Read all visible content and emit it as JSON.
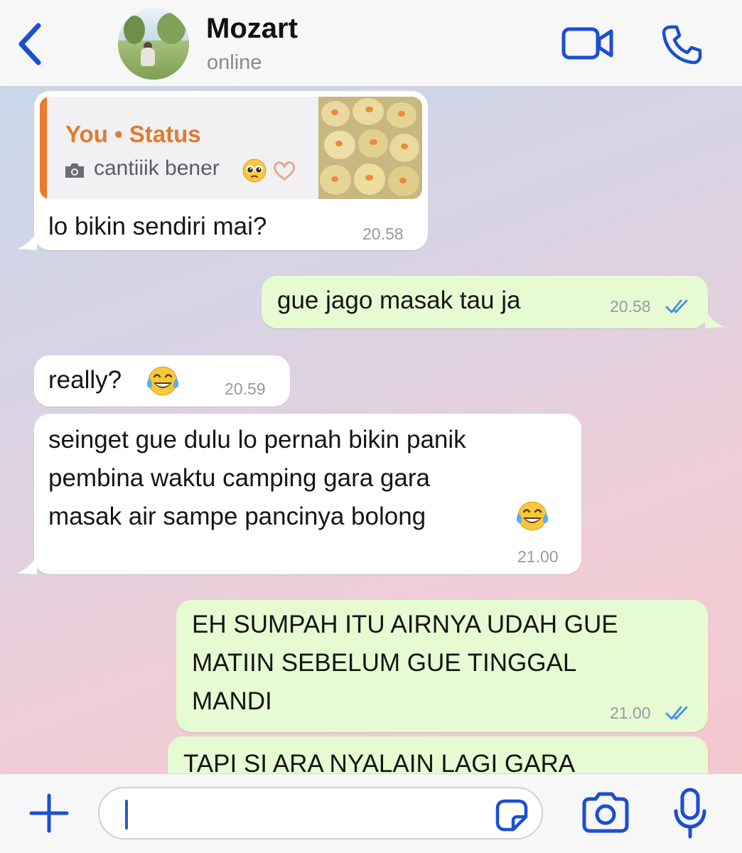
{
  "header": {
    "contact_name": "Mozart",
    "contact_status": "online",
    "back_icon": "chevron-left-icon",
    "video_icon": "video-camera-icon",
    "phone_icon": "phone-icon",
    "accent_color": "#1a4fd0"
  },
  "messages": [
    {
      "direction": "incoming",
      "reply": {
        "title": "You • Status",
        "caption": "cantiiik bener",
        "caption_icon": "camera-icon",
        "emojis": [
          "pleading-face",
          "heart-hands"
        ]
      },
      "text": "lo bikin sendiri mai?",
      "time": "20.58"
    },
    {
      "direction": "outgoing",
      "text": "gue jago masak tau ja",
      "time": "20.58",
      "status": "read"
    },
    {
      "direction": "incoming",
      "text": "really?",
      "emoji": "face-with-tears-of-joy",
      "time": "20.59"
    },
    {
      "direction": "incoming",
      "lines": [
        "seinget gue dulu lo pernah bikin panik",
        "pembina waktu camping gara gara",
        "masak air sampe pancinya bolong"
      ],
      "emoji": "face-with-tears-of-joy",
      "time": "21.00"
    },
    {
      "direction": "outgoing",
      "lines": [
        "EH SUMPAH ITU AIRNYA UDAH GUE",
        "MATIIN SEBELUM GUE TINGGAL",
        "MANDI"
      ],
      "time": "21.00",
      "status": "read"
    },
    {
      "direction": "outgoing",
      "lines": [
        "TAPI SI ARA NYALAIN LAGI GARA"
      ]
    }
  ],
  "composer": {
    "plus_icon": "plus-icon",
    "sticker_icon": "sticker-icon",
    "camera_icon": "camera-icon",
    "mic_icon": "microphone-icon",
    "input_value": ""
  },
  "colors": {
    "incoming_bubble": "#ffffff",
    "outgoing_bubble": "#e7fbd3",
    "reply_accent": "#ee7a2e",
    "read_ticks": "#4a8fe0"
  }
}
